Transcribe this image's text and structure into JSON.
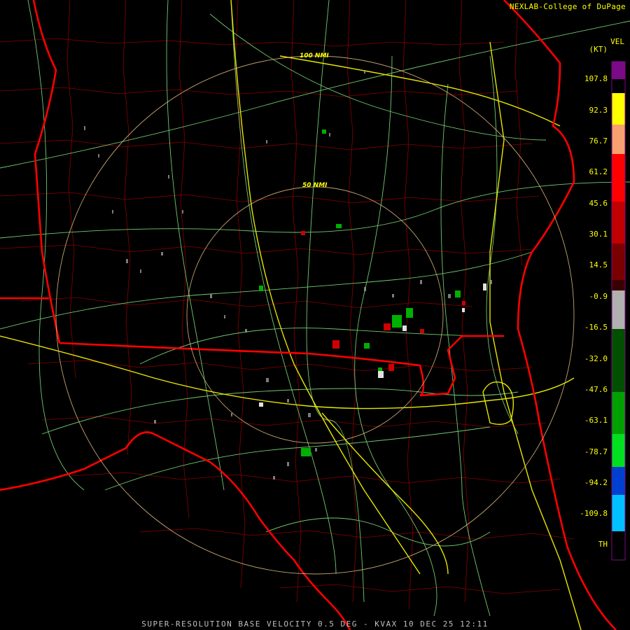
{
  "header": {
    "credit": "NEXLAB-College of DuPage"
  },
  "legend": {
    "product": "VEL",
    "units": "(KT)",
    "ticks": [
      "107.8",
      "92.3",
      "76.7",
      "61.2",
      "45.6",
      "30.1",
      "14.5",
      "-0.9",
      "-16.5",
      "-32.0",
      "-47.6",
      "-63.1",
      "-78.7",
      "-94.2",
      "-109.8",
      "TH"
    ],
    "colors": [
      "#7b0a86",
      "#ffff00",
      "#f8a070",
      "#ff0000",
      "#c00000",
      "#7a0000",
      "#3a0000",
      "#b0b0b0",
      "#005000",
      "#00a000",
      "#00e020",
      "#0040d0",
      "#00c0ff",
      "#000000"
    ]
  },
  "range_rings": {
    "inner_label": "50 NMI",
    "outer_label": "100 NMI"
  },
  "footer": {
    "caption": "SUPER-RESOLUTION BASE VELOCITY 0.5 DEG - KVAX 10 DEC 25 12:11"
  }
}
